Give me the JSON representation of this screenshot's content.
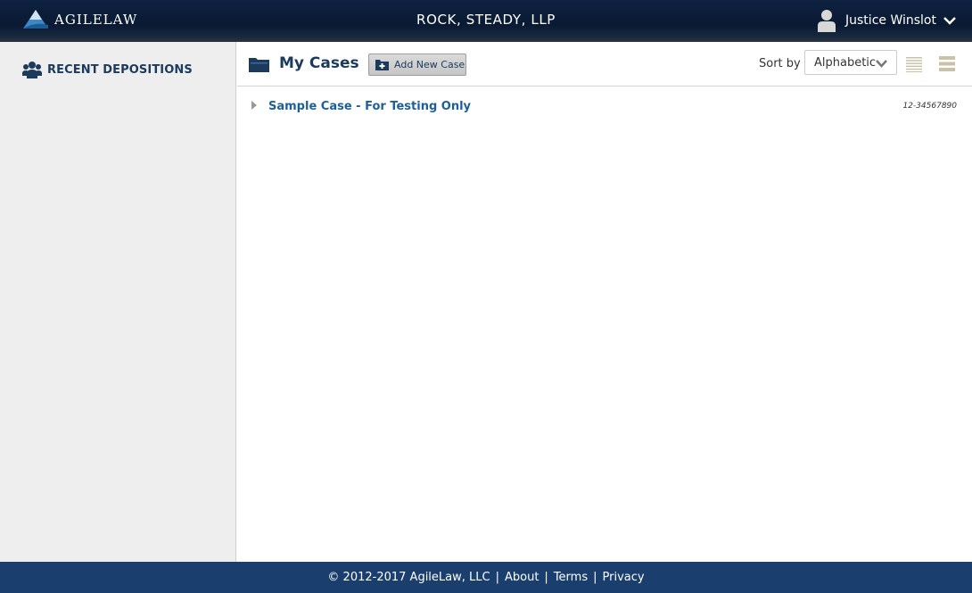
{
  "header": {
    "logo_text": "AGILELAW",
    "firm_name": "ROCK, STEADY, LLP",
    "user_name": "Justice Winslot",
    "icons": [
      "agilelaw-logo-icon",
      "user-avatar-icon",
      "chevron-down-icon"
    ]
  },
  "sidebar": {
    "items": [
      {
        "label": "RECENT DEPOSITIONS",
        "icon": "users-group-icon"
      }
    ]
  },
  "main": {
    "title": "My Cases",
    "add_button_label": "Add New Case",
    "sort_label": "Sort by",
    "sort_value": "Alphabetic",
    "view_icons": [
      "compact-list-view-icon",
      "expanded-list-view-icon"
    ],
    "cases": [
      {
        "name": "Sample Case - For Testing Only",
        "number": "12-34567890"
      }
    ]
  },
  "footer": {
    "copyright": "© 2012-2017 AgileLaw, LLC",
    "separator": "|",
    "links": [
      "About",
      "Terms",
      "Privacy"
    ]
  },
  "colors": {
    "header_bg": "#0d2140",
    "footer_bg": "#1a3f6e",
    "sidebar_bg": "#eeeeee",
    "title_text": "#1b3a5c",
    "link_blue": "#1d5f99"
  }
}
